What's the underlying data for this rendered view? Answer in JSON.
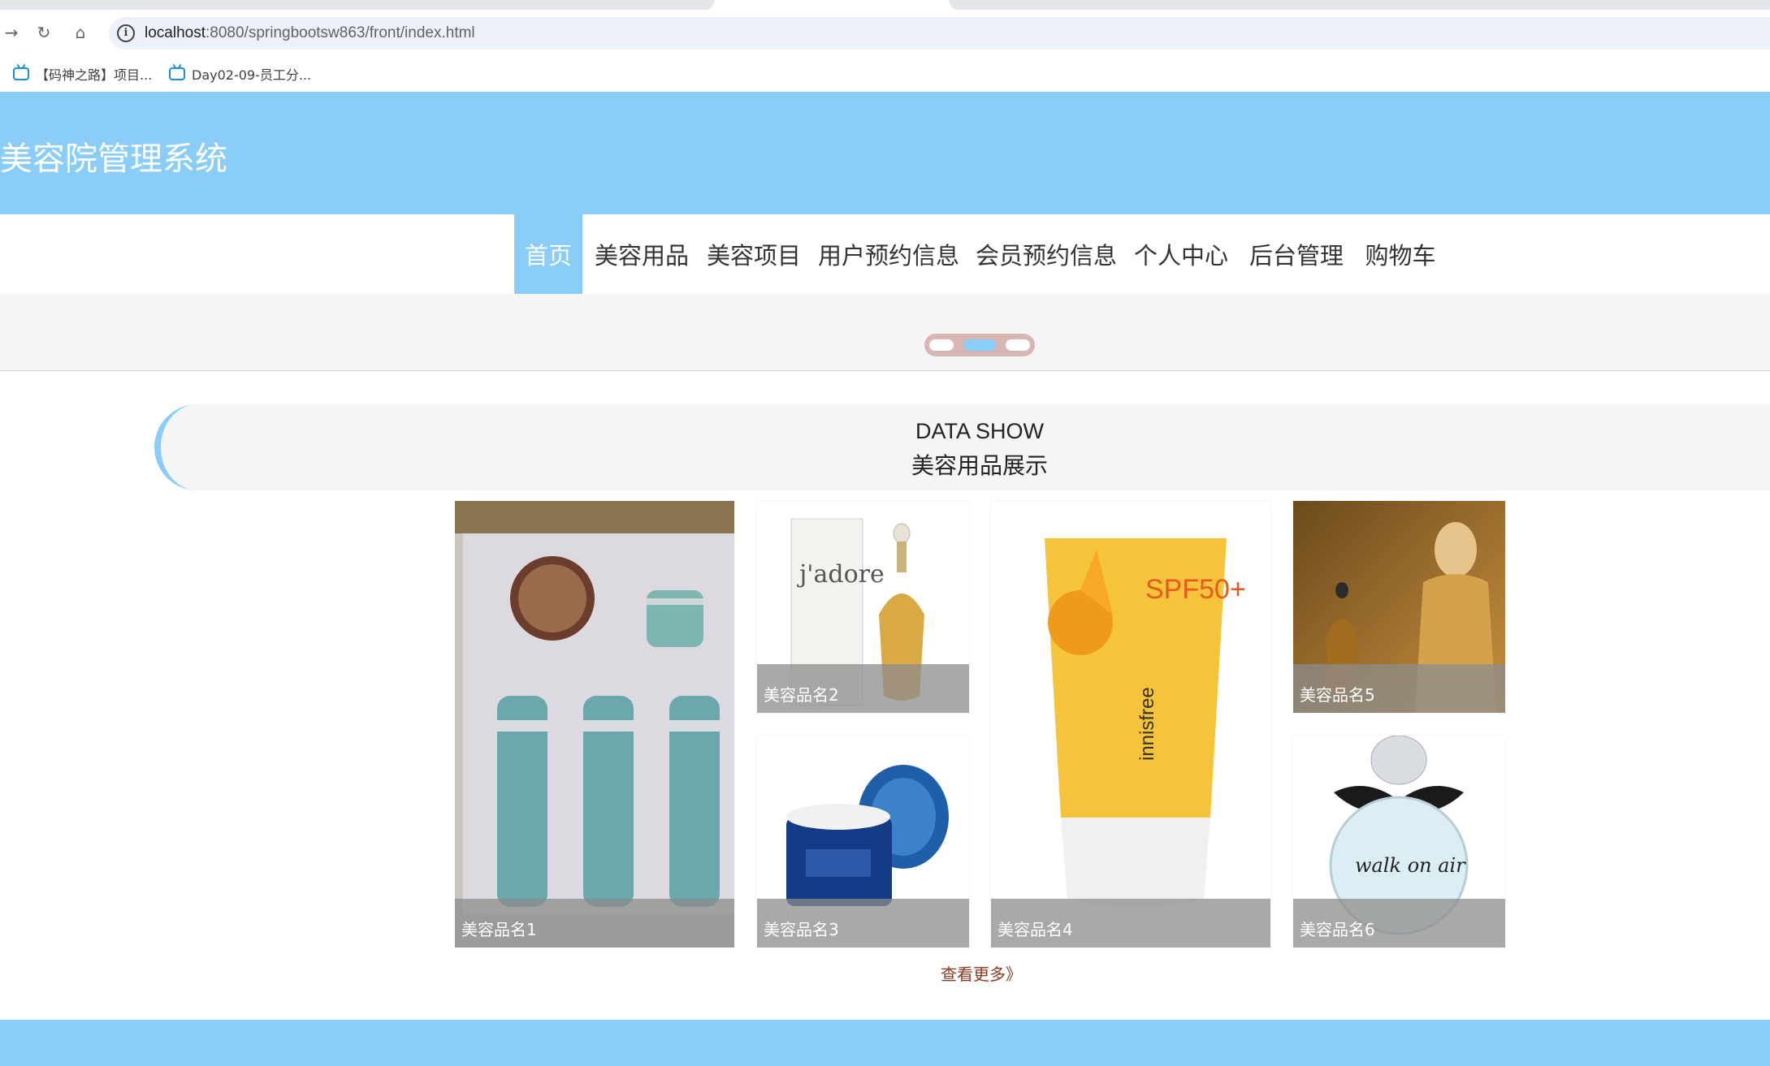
{
  "browser": {
    "url_host": "localhost",
    "url_path": ":8080/springbootsw863/front/index.html",
    "bookmarks": [
      {
        "label": "【码神之路】项目..."
      },
      {
        "label": "Day02-09-员工分..."
      }
    ]
  },
  "header": {
    "title": "美容院管理系统"
  },
  "nav": {
    "items": [
      {
        "label": "首页"
      },
      {
        "label": "美容用品"
      },
      {
        "label": "美容项目"
      },
      {
        "label": "用户预约信息"
      },
      {
        "label": "会员预约信息"
      },
      {
        "label": "个人中心"
      },
      {
        "label": "后台管理"
      },
      {
        "label": "购物车"
      }
    ],
    "active_index": 0
  },
  "carousel": {
    "slide_count": 3,
    "active_index": 1
  },
  "section": {
    "title_en": "DATA SHOW",
    "title_cn": "美容用品展示"
  },
  "products": [
    {
      "name": "美容品名1",
      "icon": "skincare-set-image"
    },
    {
      "name": "美容品名2",
      "icon": "perfume-jadore-image"
    },
    {
      "name": "美容品名3",
      "icon": "cream-jar-image"
    },
    {
      "name": "美容品名4",
      "icon": "sunblock-tube-image"
    },
    {
      "name": "美容品名5",
      "icon": "perfume-ad-image"
    },
    {
      "name": "美容品名6",
      "icon": "perfume-bottle-image"
    }
  ],
  "more_label": "查看更多》",
  "colors": {
    "accent": "#8acdf9",
    "more_link": "#8b3a1e"
  }
}
